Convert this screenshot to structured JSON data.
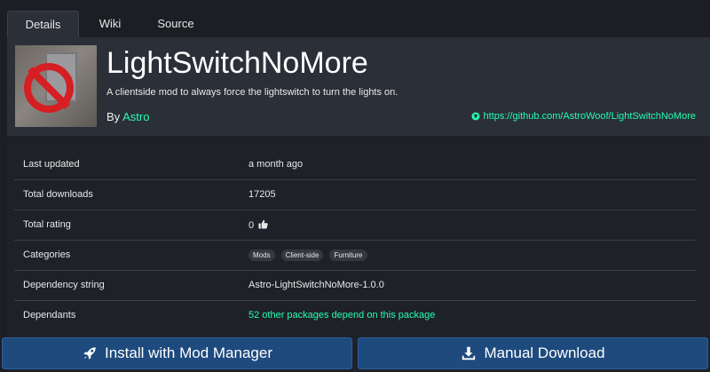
{
  "tabs": [
    {
      "label": "Details",
      "active": true
    },
    {
      "label": "Wiki",
      "active": false
    },
    {
      "label": "Source",
      "active": false
    }
  ],
  "package": {
    "name": "LightSwitchNoMore",
    "description": "A clientside mod to always force the lightswitch to turn the lights on.",
    "by_label": "By",
    "author": "Astro",
    "website": "https://github.com/AstroWoof/LightSwitchNoMore",
    "thumbnail_icon": "no-lightswitch-sign-icon"
  },
  "info": {
    "last_updated": {
      "label": "Last updated",
      "value": "a month ago"
    },
    "total_downloads": {
      "label": "Total downloads",
      "value": "17205"
    },
    "total_rating": {
      "label": "Total rating",
      "value": "0"
    },
    "categories": {
      "label": "Categories",
      "tags": [
        "Mods",
        "Client-side",
        "Furniture"
      ]
    },
    "dependency_string": {
      "label": "Dependency string",
      "value": "Astro-LightSwitchNoMore-1.0.0"
    },
    "dependants": {
      "label": "Dependants",
      "value": "52 other packages depend on this package"
    }
  },
  "actions": {
    "install_label": "Install with Mod Manager",
    "download_label": "Manual Download"
  },
  "colors": {
    "accent": "#23ffb0",
    "button": "#1e4a7e",
    "background": "#1c1e24",
    "header": "#2b2f38"
  }
}
